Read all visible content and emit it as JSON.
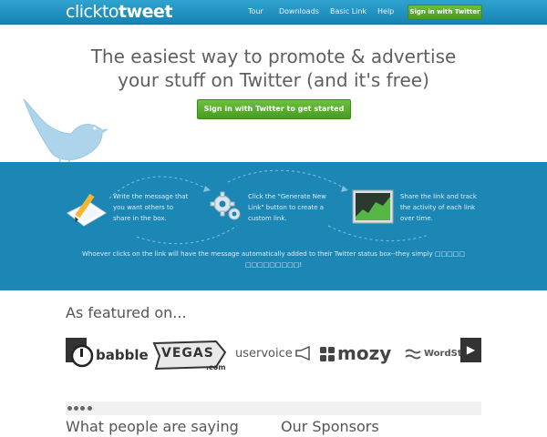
{
  "header": {
    "logo_light": "clickto",
    "logo_bold": "tweet",
    "nav": [
      "Tour",
      "Downloads",
      "Basic Link",
      "Help"
    ],
    "signin_label": "Sign in with Twitter"
  },
  "hero": {
    "headline_line1": "The easiest way to promote & advertise",
    "headline_line2": "your stuff on Twitter (and it's free)",
    "cta_label": "Sign in with Twitter to get started"
  },
  "steps": [
    {
      "text": [
        "Write the message that",
        "you want others to",
        "share in the box."
      ],
      "icon": "pencil-paper-icon"
    },
    {
      "text": [
        "Click the \"Generate New",
        "Link\" button to create a",
        "custom link."
      ],
      "icon": "gears-icon"
    },
    {
      "text": [
        "Share the link and track",
        "the activity of each link",
        "over time."
      ],
      "icon": "chart-icon"
    }
  ],
  "band_footer_line1": "Whoever clicks on the link will have the message automatically added to their Twitter status box--they simply □□□□□",
  "band_footer_line2": "□□□□□□□□□!",
  "featured": {
    "title": "As featured on...",
    "brands": [
      "babble",
      "VEGAS",
      ".com",
      "uservoice",
      "mozy",
      "WordStr"
    ],
    "prev_icon": "chevron-left-icon",
    "next_icon": "chevron-right-icon"
  },
  "bottom": {
    "left_title": "What people are saying",
    "right_title": "Our Sponsors"
  },
  "colors": {
    "topbar": "#1c8bbd",
    "band": "#1c86b5",
    "green": "#4ea52a",
    "bird": "#aed4ec"
  }
}
